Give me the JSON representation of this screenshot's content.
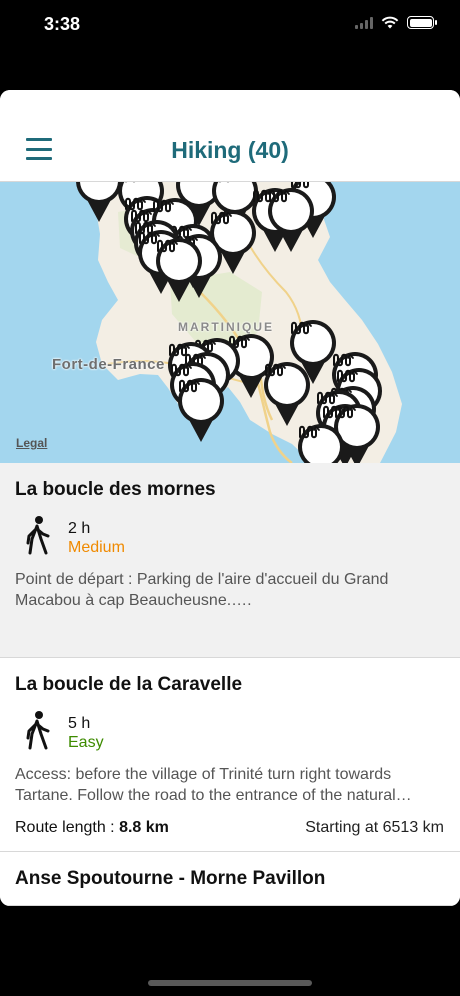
{
  "status_bar": {
    "time": "3:38"
  },
  "header": {
    "title": "Hiking (40)"
  },
  "map": {
    "labels": {
      "region": "MARTINIQUE",
      "city": "Fort-de-France"
    },
    "legal": "Legal",
    "pin_icon": "hiking-trail-icon"
  },
  "hikes": [
    {
      "title": "La boucle des mornes",
      "duration": "2 h",
      "difficulty": "Medium",
      "description": "Point de départ : Parking de l'aire d'accueil du Grand Macabou à cap Beaucheusne.…."
    },
    {
      "title": "La boucle de la Caravelle",
      "duration": "5 h",
      "difficulty": "Easy",
      "description": "Access: before the village of Trinité turn right towards Tartane. Follow the road to the entrance of the natural…",
      "route_length_label": "Route length :",
      "route_length_value": "8.8 km",
      "starting_at": "Starting at 6513 km"
    },
    {
      "title": "Anse Spoutourne - Morne Pavillon"
    }
  ],
  "colors": {
    "accent": "#1f6b7a",
    "difficulty_medium": "#f08a00",
    "difficulty_easy": "#3d8b00",
    "sea": "#a3d6ee",
    "land": "#f3eee4"
  }
}
